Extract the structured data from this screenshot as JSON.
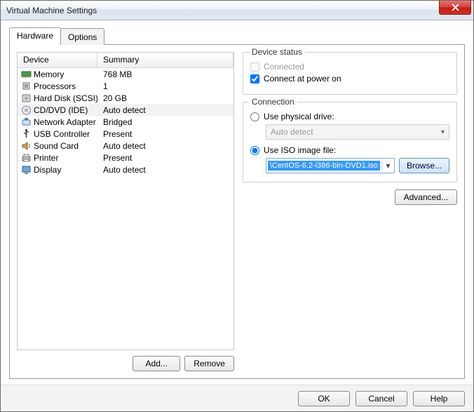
{
  "window": {
    "title": "Virtual Machine Settings"
  },
  "tabs": {
    "hardware": "Hardware",
    "options": "Options"
  },
  "list": {
    "header": {
      "device": "Device",
      "summary": "Summary"
    },
    "items": [
      {
        "name": "Memory",
        "summary": "768 MB",
        "icon": "memory"
      },
      {
        "name": "Processors",
        "summary": "1",
        "icon": "cpu"
      },
      {
        "name": "Hard Disk (SCSI)",
        "summary": "20 GB",
        "icon": "hdd"
      },
      {
        "name": "CD/DVD (IDE)",
        "summary": "Auto detect",
        "icon": "cd",
        "selected": true
      },
      {
        "name": "Network Adapter",
        "summary": "Bridged",
        "icon": "net"
      },
      {
        "name": "USB Controller",
        "summary": "Present",
        "icon": "usb"
      },
      {
        "name": "Sound Card",
        "summary": "Auto detect",
        "icon": "sound"
      },
      {
        "name": "Printer",
        "summary": "Present",
        "icon": "printer"
      },
      {
        "name": "Display",
        "summary": "Auto detect",
        "icon": "display"
      }
    ]
  },
  "buttons": {
    "add": "Add...",
    "remove": "Remove",
    "ok": "OK",
    "cancel": "Cancel",
    "help": "Help",
    "advanced": "Advanced...",
    "browse": "Browse..."
  },
  "status": {
    "group": "Device status",
    "connected": "Connected",
    "connectedChecked": false,
    "connectedDisabled": true,
    "connectPower": "Connect at power on",
    "connectPowerChecked": true
  },
  "connection": {
    "group": "Connection",
    "physical": "Use physical drive:",
    "physicalSelected": false,
    "physicalValue": "Auto detect",
    "iso": "Use ISO image file:",
    "isoSelected": true,
    "isoValue": "\\CentOS-6.2-i386-bin-DVD1.iso"
  }
}
